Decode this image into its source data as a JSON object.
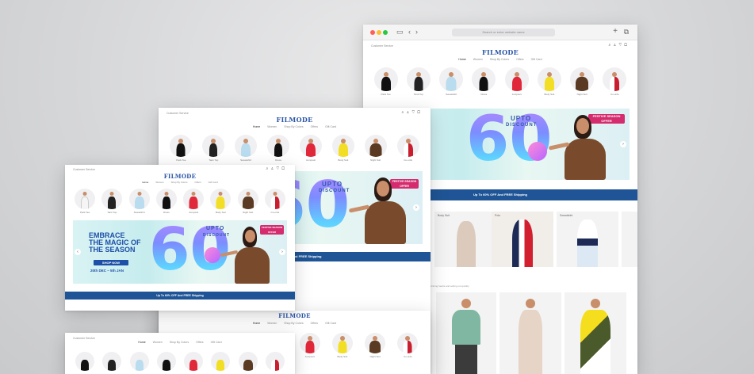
{
  "browser": {
    "url_placeholder": "Search or enter website name"
  },
  "site": {
    "help": "Customer Service",
    "logo": "FILMODE",
    "nav": [
      "Home",
      "Women",
      "Shop By Colors",
      "Offers",
      "Gift Card"
    ],
    "categories": [
      "Pack Tee",
      "Tank Top",
      "Sweatshirt",
      "Dress",
      "Jumpsuit",
      "Body Suit",
      "Night Suit",
      "Co-ords"
    ],
    "banner": {
      "headline": [
        "EMBRACE",
        "THE MAGIC OF",
        "THE SEASON"
      ],
      "upto": "UPTO",
      "discount": "DISCOUNT",
      "big_number": "60",
      "shop_now": "SHOP NOW",
      "dates": "20th DEC – 5th JAN",
      "festive_brand": "Filmode",
      "festive_line1": "FESTIVE SEASON",
      "festive_line2": "OFFER"
    },
    "promo": "Up To 60% OFF And FREE Shipping",
    "collection_labels": [
      "Body Suit",
      "Polo",
      "Sweatshirt"
    ],
    "bestsellers": {
      "title": "Bestsellers",
      "subtitle": "Get your hands on the most sought after styles that are winning hearts and selling out quickly"
    }
  },
  "colors": {
    "brand_blue": "#2a55a8",
    "promo_bar": "#1f5596",
    "festive_pink": "#d42c6e"
  }
}
